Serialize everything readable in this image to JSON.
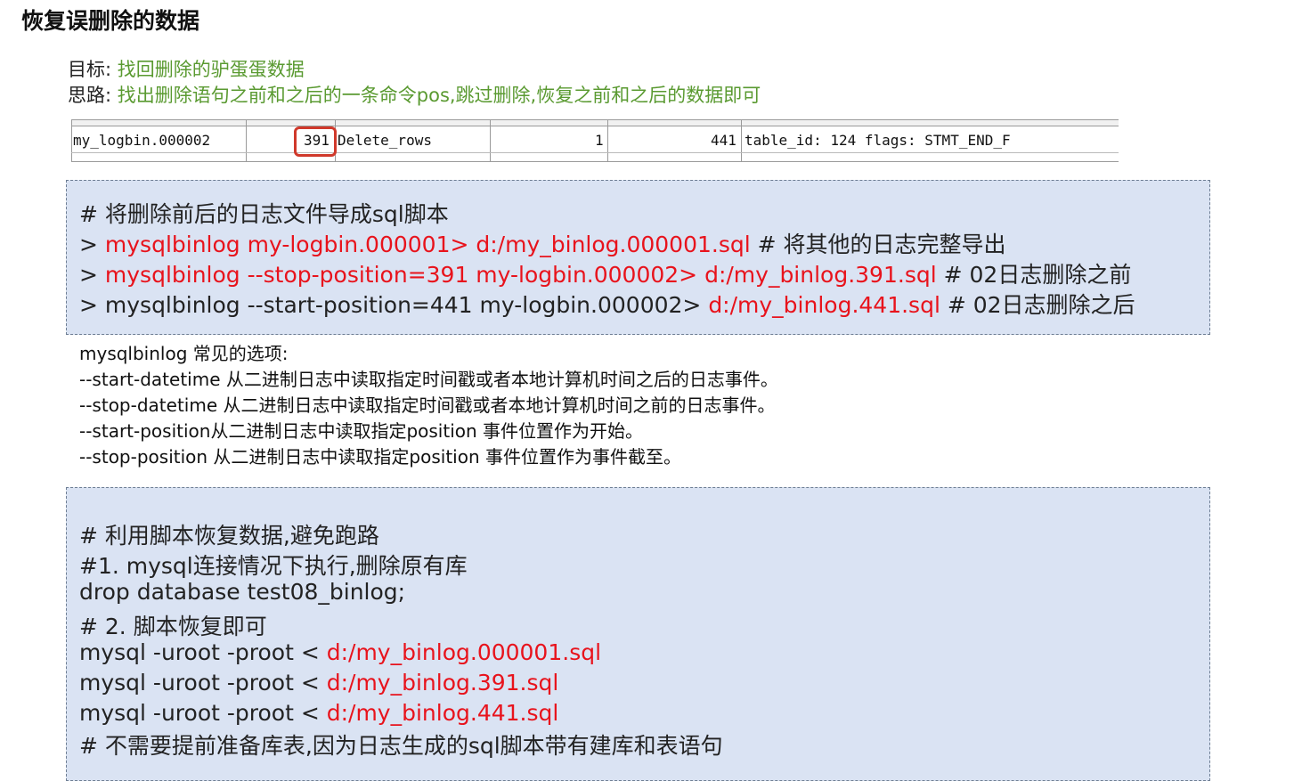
{
  "title": "恢复误删除的数据",
  "goal": {
    "label": "目标: ",
    "text": "找回删除的驴蛋蛋数据"
  },
  "idea": {
    "label": "思路: ",
    "text": "找出删除语句之前和之后的一条命令pos,跳过删除,恢复之前和之后的数据即可"
  },
  "binlog_row": {
    "log_name": "my_logbin.000002",
    "pos": "391",
    "event_type": "Delete_rows",
    "server_id": "1",
    "end_log_pos": "441",
    "info": "table_id: 124 flags: STMT_END_F"
  },
  "box1": {
    "comment": "# 将删除前后的日志文件导成sql脚本",
    "line1": {
      "prompt": "> ",
      "cmd": "mysqlbinlog my-logbin.000001> d:/my_binlog.000001.sql",
      "comment": " # 将其他的日志完整导出"
    },
    "line2": {
      "prompt": "> ",
      "cmd": "mysqlbinlog --stop-position=391 my-logbin.000002> d:/my_binlog.391.sql",
      "comment": " # 02日志删除之前"
    },
    "line3": {
      "prefix": "> mysqlbinlog --start-position=441 my-logbin.000002> ",
      "path": "d:/my_binlog.441.sql",
      "comment": " # 02日志删除之后"
    }
  },
  "options": {
    "heading": "mysqlbinlog 常见的选项:",
    "items": [
      "--start-datetime 从二进制日志中读取指定时间戳或者本地计算机时间之后的日志事件。",
      "--stop-datetime 从二进制日志中读取指定时间戳或者本地计算机时间之前的日志事件。",
      "--start-position从二进制日志中读取指定position 事件位置作为开始。",
      "--stop-position 从二进制日志中读取指定position 事件位置作为事件截至。"
    ]
  },
  "box2": {
    "comment1": "# 利用脚本恢复数据,避免跑路",
    "comment2": "#1. mysql连接情况下执行,删除原有库",
    "drop": "drop database test08_binlog;",
    "comment3": "# 2. 脚本恢复即可",
    "restore_prefix": "mysql -uroot -proot < ",
    "paths": [
      "d:/my_binlog.000001.sql",
      "d:/my_binlog.391.sql",
      "d:/my_binlog.441.sql"
    ],
    "comment4": "# 不需要提前准备库表,因为日志生成的sql脚本带有建库和表语句"
  },
  "colors": {
    "green": "#5a9a31",
    "red": "#e8131c",
    "code_bg": "#dae3f3",
    "highlight": "#d0392b"
  }
}
